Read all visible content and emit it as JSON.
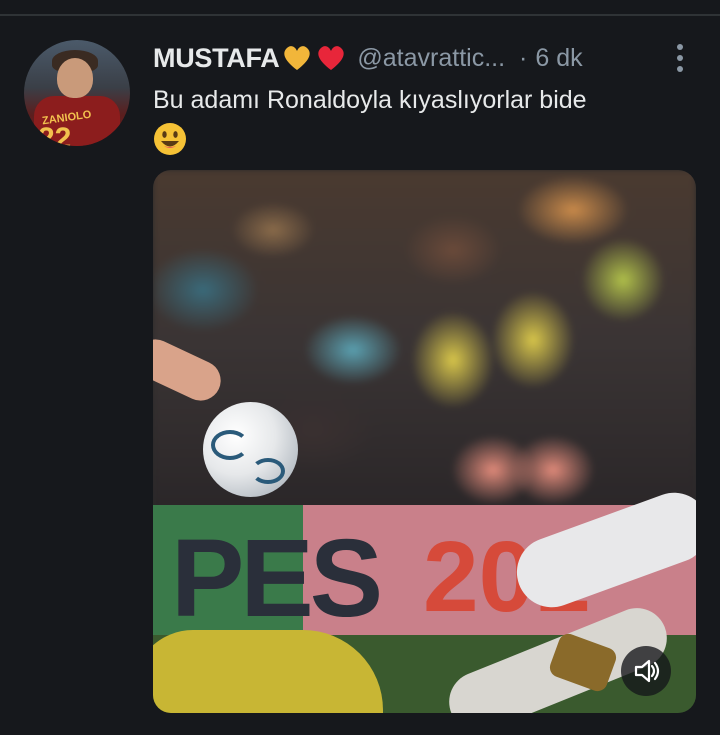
{
  "tweet": {
    "display_name": "MUSTAFA",
    "handle": "@atavrattic...",
    "separator": "·",
    "time": "6 dk",
    "text": "Bu adamı Ronaldoyla kıyaslıyorlar bide",
    "emoji": "smiling-face-emoji",
    "name_emojis": [
      "yellow-heart-icon",
      "red-heart-icon"
    ],
    "avatar": {
      "jersey_name": "ZANIOLO",
      "jersey_number": "22"
    }
  },
  "media": {
    "board_text": "PES",
    "board_year": "201",
    "sound_icon": "speaker-muted-icon"
  },
  "colors": {
    "background": "#16181c",
    "text_primary": "#e7e9ea",
    "text_secondary": "#8b98a5",
    "heart_yellow": "#f2b63a",
    "heart_red": "#e8263a"
  }
}
